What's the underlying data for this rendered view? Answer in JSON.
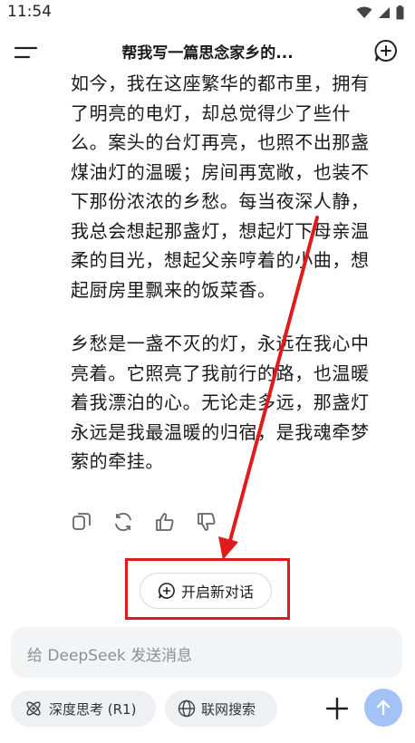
{
  "status_bar": {
    "time": "11:54"
  },
  "header": {
    "title": "帮我写一篇思念家乡的..."
  },
  "message": {
    "paragraphs": [
      "如今，我在这座繁华的都市里，拥有了明亮的电灯，却总觉得少了些什么。案头的台灯再亮，也照不出那盏煤油灯的温暖；房间再宽敞，也装不下那份浓浓的乡愁。每当夜深人静，我总会想起那盏灯，想起灯下母亲温柔的目光，想起父亲哼着的小曲，想起厨房里飘来的饭菜香。",
      "乡愁是一盏不灭的灯，永远在我心中亮着。它照亮了我前行的路，也温暖着我漂泊的心。无论走多远，那盏灯永远是我最温暖的归宿，是我魂牵梦萦的牵挂。"
    ],
    "actions": [
      "copy-icon",
      "regenerate-icon",
      "thumbs-up-icon",
      "thumbs-down-icon"
    ]
  },
  "new_chat": {
    "label": "开启新对话"
  },
  "input": {
    "placeholder": "给 DeepSeek 发送消息"
  },
  "bottom": {
    "deep_think_label": "深度思考 (R1)",
    "web_search_label": "联网搜索"
  },
  "colors": {
    "highlight": "#e01b1b",
    "send_button": "#a3c2f5",
    "input_bg": "#f3f4f6"
  }
}
